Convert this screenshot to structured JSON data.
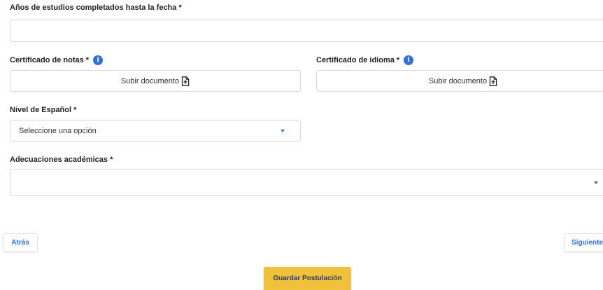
{
  "form": {
    "years_label": "Años de estudios completados hasta la fecha *",
    "years_value": "",
    "grades_label": "Certificado de notas *",
    "grades_upload": "Subir documento",
    "language_cert_label": "Certificado de idioma *",
    "language_cert_upload": "Subir documento",
    "spanish_level_label": "Nivel de Español *",
    "spanish_level_value": "Seleccione una opción",
    "accommodations_label": "Adecuaciones académicas *",
    "accommodations_value": ""
  },
  "nav": {
    "back_label": "Atrás",
    "next_label": "Siguiente",
    "save_label": "Guardar Postulación"
  },
  "colors": {
    "accent_blue": "#2f6fd6",
    "save_button": "#f0c13a",
    "border": "#d9d9d9"
  },
  "icons": {
    "info": "info-icon",
    "upload": "file-upload-icon",
    "dropdown": "caret-down-icon"
  }
}
